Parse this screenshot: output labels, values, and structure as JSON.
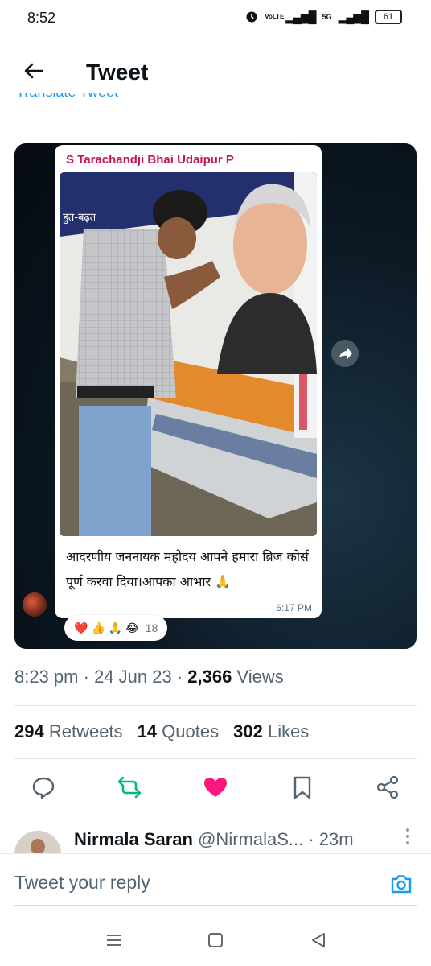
{
  "status_bar": {
    "time": "8:52",
    "volte_label": "VoLTE",
    "network": "5G",
    "battery": "61"
  },
  "header": {
    "title": "Tweet",
    "translate_link": "Translate Tweet"
  },
  "media": {
    "chat_sender": "S Tarachandji Bhai Udaipur P",
    "chat_message": "आदरणीय जननायक महोदय आपने हमारा ब्रिज कोर्स पूर्ण करवा दिया।आपका आभार 🙏",
    "chat_time": "6:17 PM",
    "reaction_emojis": [
      "❤️",
      "👍",
      "🙏",
      "😂"
    ],
    "reaction_count": "18",
    "photo_banner_text": "हुत-बढ़त"
  },
  "tweet_meta": {
    "time": "8:23 pm",
    "date": "24 Jun 23",
    "views_count": "2,366",
    "views_label": "Views"
  },
  "tweet_stats": {
    "retweets_count": "294",
    "retweets_label": "Retweets",
    "quotes_count": "14",
    "quotes_label": "Quotes",
    "likes_count": "302",
    "likes_label": "Likes"
  },
  "colors": {
    "like_active": "#f91880",
    "retweet": "#00ba7c",
    "link": "#1d9bf0",
    "sender_name": "#c2185b"
  },
  "next_tweet": {
    "author_name": "Nirmala Saran",
    "handle": "@NirmalaS...",
    "time": "· 23m"
  },
  "reply": {
    "placeholder": "Tweet your reply"
  }
}
